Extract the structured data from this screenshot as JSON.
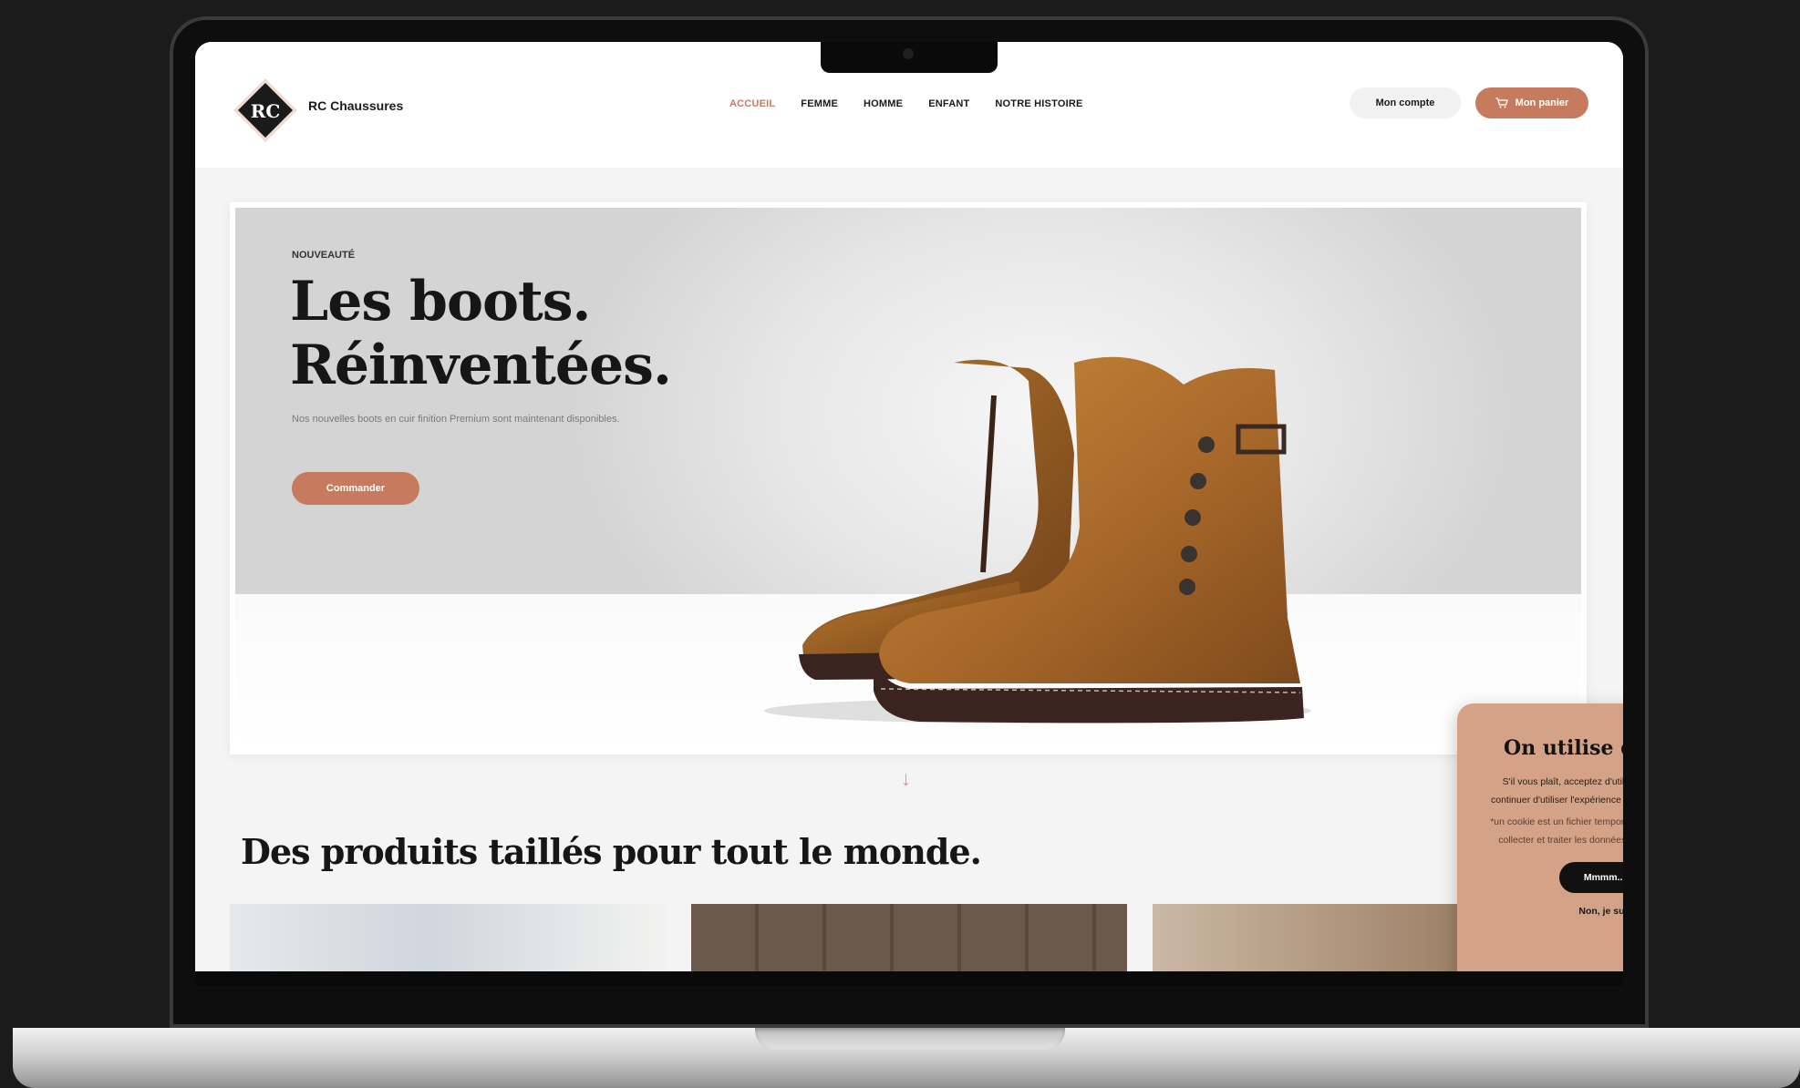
{
  "header": {
    "brand": "RC Chaussures",
    "logo_text": "RC",
    "nav": [
      "ACCUEIL",
      "FEMME",
      "HOMME",
      "ENFANT",
      "NOTRE HISTOIRE"
    ],
    "active_nav": "ACCUEIL",
    "account_label": "Mon compte",
    "cart_label": "Mon panier"
  },
  "hero": {
    "eyebrow": "NOUVEAUTÉ",
    "title_line1": "Les boots.",
    "title_line2": "Réinventées.",
    "description": "Nos nouvelles boots en cuir finition Premium sont maintenant disponibles.",
    "cta": "Commander"
  },
  "section": {
    "title": "Des produits taillés pour tout le monde."
  },
  "cookie": {
    "title": "On utilise des cookies.",
    "text": "S'il vous plaît, acceptez d'utiliser nos délicieux cookies* pour continuer d'utiliser l'expérience optimale de notre site internet ! 🍪",
    "note": "*un cookie est un fichier temporaire. Les cookies sont utilisés pour collecter et traiter les données personnelles de vos utilisateurs",
    "accept": "Mmmm... J'accepte !",
    "decline": "Non, je suis à la diète !"
  },
  "colors": {
    "accent": "#c77b5e",
    "cookie_bg": "#d4a287",
    "dark": "#161616"
  }
}
